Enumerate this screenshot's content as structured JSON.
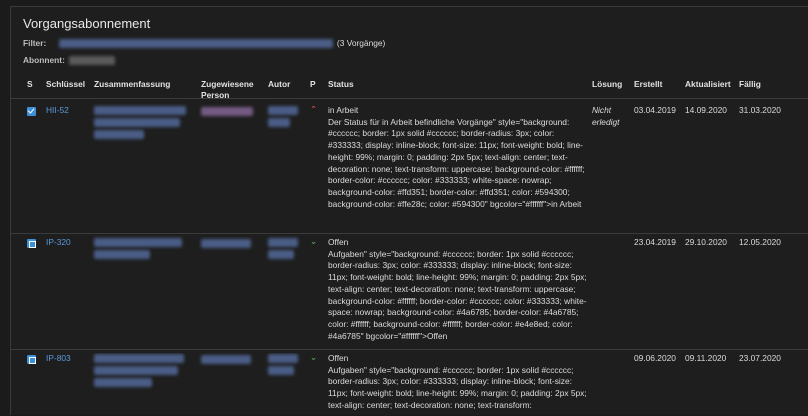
{
  "page": {
    "title": "Vorgangsabonnement",
    "filter_label": "Filter:",
    "filter_count": "(3 Vorgänge)",
    "abonnent_label": "Abonnent:"
  },
  "columns": [
    "S",
    "Schlüssel",
    "Zusammenfassung",
    "Zugewiesene Person",
    "Autor",
    "P",
    "Status",
    "Lösung",
    "Erstellt",
    "Aktualisiert",
    "Fällig"
  ],
  "column_colors": {
    "link": "#5c9bdc",
    "priority_high": "#d64a4a",
    "priority_low": "#4caa53"
  },
  "issues": [
    {
      "type_icon": "checkbox-icon",
      "key": "HII-52",
      "priority_icon": "chevron-up-icon",
      "status_title": "in Arbeit",
      "status_text": "Der Status für in Arbeit befindliche Vorgänge\" style=\"background: #cccccc; border: 1px solid #cccccc; border-radius: 3px; color: #333333; display: inline-block; font-size: 11px; font-weight: bold; line-height: 99%; margin: 0; padding: 2px 5px; text-align: center; text-decoration: none; text-transform: uppercase; background-color: #ffffff; border-color: #cccccc; color: #333333; white-space: nowrap; background-color: #ffd351; border-color: #ffd351; color: #594300; background-color: #ffe28c; color: #594300\" bgcolor=\"#ffffff\">in Arbeit",
      "resolution": "Nicht erledigt",
      "created": "03.04.2019",
      "updated": "14.09.2020",
      "due": "31.03.2020"
    },
    {
      "type_icon": "task-icon",
      "key": "IP-320",
      "priority_icon": "double-chevron-down-icon",
      "status_title": "Offen",
      "status_text": "Aufgaben\" style=\"background: #cccccc; border: 1px solid #cccccc; border-radius: 3px; color: #333333; display: inline-block; font-size: 11px; font-weight: bold; line-height: 99%; margin: 0; padding: 2px 5px; text-align: center; text-decoration: none; text-transform: uppercase; background-color: #ffffff; border-color: #cccccc; color: #333333; white-space: nowrap; background-color: #4a6785; border-color: #4a6785; color: #ffffff; background-color: #ffffff; border-color: #e4e8ed; color: #4a6785\" bgcolor=\"#ffffff\">Offen",
      "resolution": "",
      "created": "23.04.2019",
      "updated": "29.10.2020",
      "due": "12.05.2020"
    },
    {
      "type_icon": "task-icon",
      "key": "IP-803",
      "priority_icon": "double-chevron-down-icon",
      "status_title": "Offen",
      "status_text": "Aufgaben\" style=\"background: #cccccc; border: 1px solid #cccccc; border-radius: 3px; color: #333333; display: inline-block; font-size: 11px; font-weight: bold; line-height: 99%; margin: 0; padding: 2px 5px; text-align: center; text-decoration: none; text-transform:",
      "resolution": "",
      "created": "09.06.2020",
      "updated": "09.11.2020",
      "due": "23.07.2020"
    }
  ]
}
